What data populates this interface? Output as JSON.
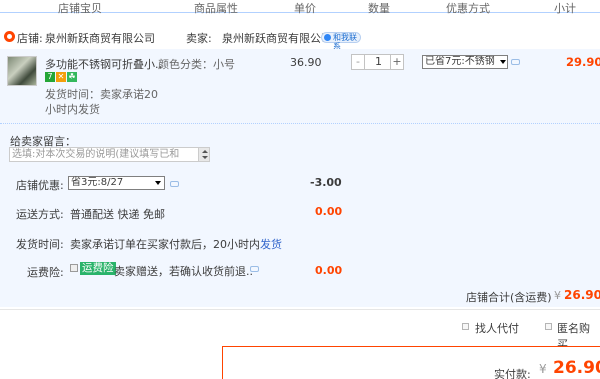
{
  "header": {
    "col_item": "店铺宝贝",
    "col_props": "商品属性",
    "col_price": "单价",
    "col_qty": "数量",
    "col_discount": "优惠方式",
    "col_subtotal": "小计"
  },
  "shop": {
    "label": "店铺:",
    "name": "泉州新跃商贸有限公司",
    "seller_label": "卖家:",
    "seller_name": "泉州新跃商贸有限公司",
    "chat_label": "和我联系"
  },
  "item": {
    "title": "多功能不锈钢可折叠小..",
    "sku": "颜色分类：小号",
    "badges": [
      "7",
      "✕",
      "☘"
    ],
    "ship_line1": "发货时间：卖家承诺20",
    "ship_line2": "小时内发货",
    "unit_price": "36.90",
    "qty_minus": "-",
    "quantity": "1",
    "qty_plus": "+",
    "discount": "已省7元:不锈钢",
    "subtotal": "29.90"
  },
  "form": {
    "message_label": "给卖家留言：",
    "message_placeholder": "选填:对本次交易的说明(建议填写已和",
    "coupon_label": "店铺优惠:",
    "coupon_value": "省3元:8/27",
    "coupon_amount": "-3.00",
    "shipping_label": "运送方式:",
    "shipping_method": "普通配送 快递 免邮",
    "shipping_amount": "0.00",
    "time_label": "发货时间:",
    "time_text": "卖家承诺订单在买家付款后，20小时内",
    "time_link": "发货",
    "insurance_label": "运费险:",
    "insurance_tag": "运费险",
    "insurance_text": "卖家赠送，若确认收货前退..",
    "insurance_amount": "0.00"
  },
  "totals": {
    "label": "店铺合计(含运费)",
    "currency": "¥",
    "value": "26.90"
  },
  "options": {
    "proxy_pay": "找人代付",
    "anonymous": "匿名购买"
  },
  "pay": {
    "label": "实付款:",
    "currency": "¥",
    "value": "26.90"
  },
  "colors": {
    "accent": "#ff4400",
    "row_bg": "#f2f7ff",
    "link": "#3366cc",
    "insurance_tag": "#2ab36a"
  }
}
